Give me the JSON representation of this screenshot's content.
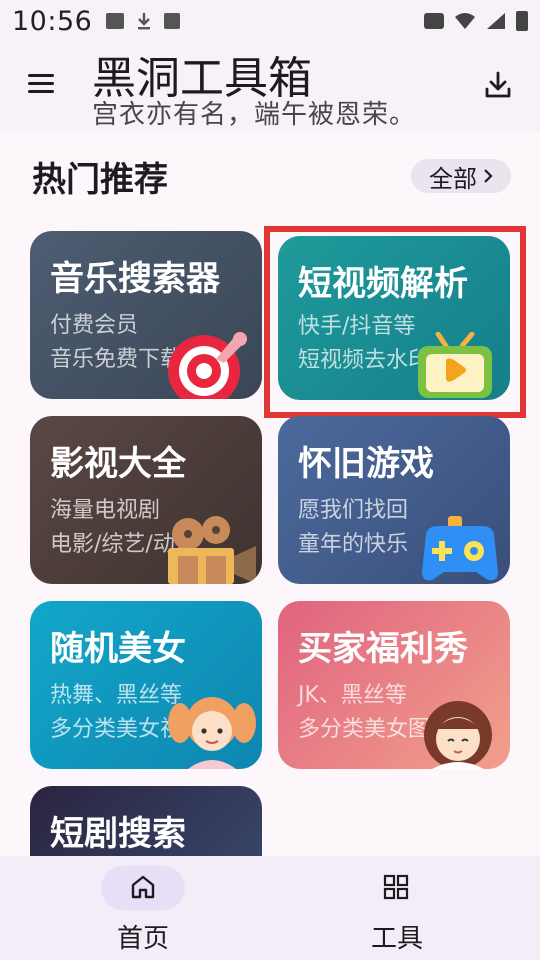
{
  "status_bar": {
    "time": "10:56"
  },
  "app_bar": {
    "title": "黑洞工具箱",
    "subtitle": "宫衣亦有名，端午被恩荣。"
  },
  "section": {
    "title": "热门推荐",
    "all_label": "全部"
  },
  "cards": [
    {
      "title": "音乐搜索器",
      "line1": "付费会员",
      "line2": "音乐免费下载",
      "icon": "target-music-icon"
    },
    {
      "title": "短视频解析",
      "line1": "快手/抖音等",
      "line2": "短视频去水印",
      "icon": "tv-play-icon"
    },
    {
      "title": "影视大全",
      "line1": "海量电视剧",
      "line2": "电影/综艺/动漫",
      "icon": "film-camera-icon"
    },
    {
      "title": "怀旧游戏",
      "line1": "愿我们找回",
      "line2": "童年的快乐",
      "icon": "gamepad-icon"
    },
    {
      "title": "随机美女",
      "line1": "热舞、黑丝等",
      "line2": "多分类美女视频",
      "icon": "girl-avatar-icon"
    },
    {
      "title": "买家福利秀",
      "line1": "JK、黑丝等",
      "line2": "多分类美女图片",
      "icon": "woman-avatar-icon"
    },
    {
      "title": "短剧搜索",
      "line1": "",
      "line2": "",
      "icon": ""
    }
  ],
  "bottom_nav": [
    {
      "label": "首页",
      "icon": "home-icon",
      "active": true
    },
    {
      "label": "工具",
      "icon": "grid-icon",
      "active": false
    }
  ],
  "colors": {
    "background": "#fdf7fb",
    "highlight": "#e03636",
    "nav_pill": "#e8def8"
  }
}
